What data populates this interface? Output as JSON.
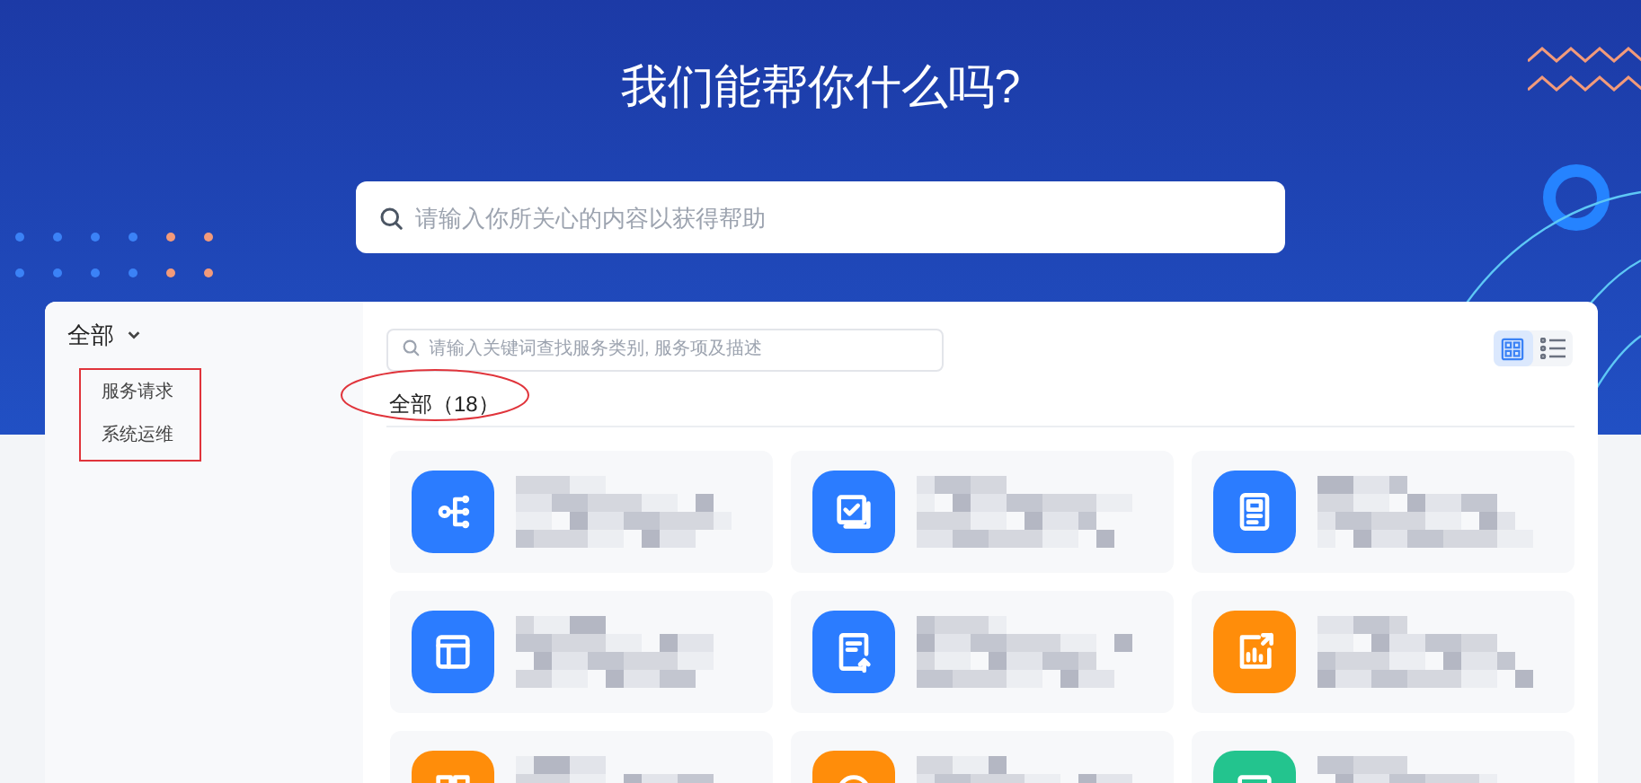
{
  "hero": {
    "title": "我们能帮你什么吗?",
    "search": {
      "placeholder": "请输入你所关心的内容以获得帮助"
    }
  },
  "sidebar": {
    "category": {
      "label": "全部",
      "expanded": true
    },
    "items": [
      {
        "label": "服务请求"
      },
      {
        "label": "系统运维"
      }
    ]
  },
  "content": {
    "search": {
      "placeholder": "请输入关键词查找服务类别, 服务项及描述"
    },
    "view_toggle": [
      {
        "kind": "grid",
        "selected": true
      },
      {
        "kind": "list",
        "selected": false
      }
    ],
    "tally": "全部（18）",
    "cards": [
      {
        "kind": "tree",
        "color": "#2b7cff"
      },
      {
        "kind": "checklist",
        "color": "#2b7cff"
      },
      {
        "kind": "document",
        "color": "#2b7cff"
      },
      {
        "kind": "layout",
        "color": "#2b7cff"
      },
      {
        "kind": "upload",
        "color": "#2b7cff"
      },
      {
        "kind": "chart",
        "color": "#ff8d0a"
      },
      {
        "kind": "apps",
        "color": "#ff8d0a"
      },
      {
        "kind": "circle",
        "color": "#ff8d0a"
      },
      {
        "kind": "monitor",
        "color": "#23c48e"
      }
    ]
  }
}
